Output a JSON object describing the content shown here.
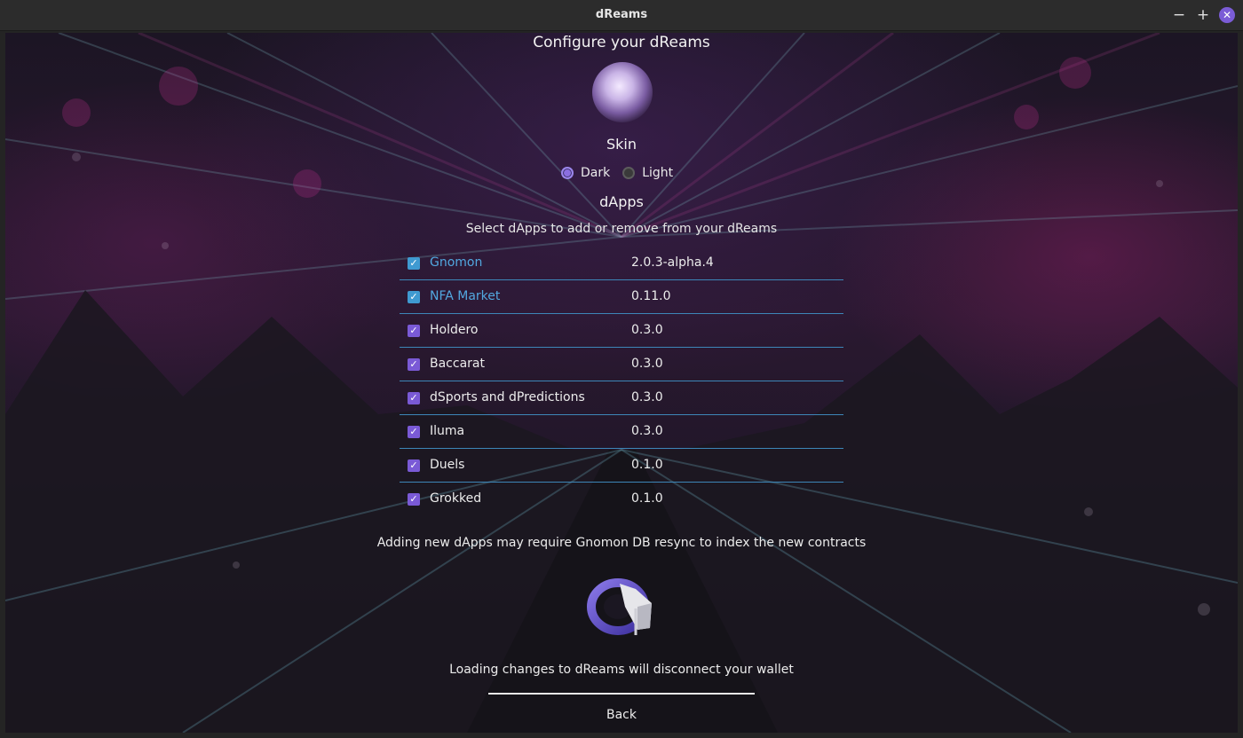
{
  "window": {
    "title": "dReams"
  },
  "header": {
    "title": "Configure your dReams"
  },
  "skin": {
    "title": "Skin",
    "options": [
      {
        "label": "Dark",
        "selected": true
      },
      {
        "label": "Light",
        "selected": false
      }
    ]
  },
  "dapps": {
    "title": "dApps",
    "subtitle": "Select dApps to add or remove from your dReams",
    "items": [
      {
        "name": "Gnomon",
        "version": "2.0.3-alpha.4",
        "checked": true,
        "link": true
      },
      {
        "name": "NFA Market",
        "version": "0.11.0",
        "checked": true,
        "link": true
      },
      {
        "name": "Holdero",
        "version": "0.3.0",
        "checked": true,
        "link": false
      },
      {
        "name": "Baccarat",
        "version": "0.3.0",
        "checked": true,
        "link": false
      },
      {
        "name": "dSports and dPredictions",
        "version": "0.3.0",
        "checked": true,
        "link": false
      },
      {
        "name": "Iluma",
        "version": "0.3.0",
        "checked": true,
        "link": false
      },
      {
        "name": "Duels",
        "version": "0.1.0",
        "checked": true,
        "link": false
      },
      {
        "name": "Grokked",
        "version": "0.1.0",
        "checked": true,
        "link": false
      }
    ]
  },
  "notes": {
    "resync": "Adding new dApps may require Gnomon DB resync to index the new contracts",
    "disconnect": "Loading changes to dReams will disconnect your wallet"
  },
  "footer": {
    "back_label": "Back"
  },
  "colors": {
    "accent": "#7b5cd6",
    "link": "#52a8e0",
    "divider": "#3d86b8"
  }
}
